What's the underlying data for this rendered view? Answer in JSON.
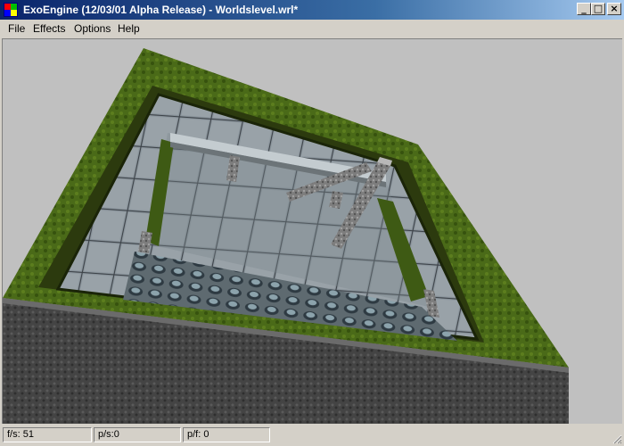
{
  "window": {
    "title": "ExoEngine (12/03/01 Alpha Release) - Worldslevel.wrl*",
    "minimize_label": "_",
    "maximize_label": "□",
    "close_label": "×"
  },
  "menu": {
    "items": [
      {
        "label": "File"
      },
      {
        "label": "Effects"
      },
      {
        "label": "Options"
      },
      {
        "label": "Help"
      }
    ]
  },
  "viewport": {
    "background_color": "#c0c0c0",
    "scene": "3d-level-render"
  },
  "statusbar": {
    "panels": [
      {
        "label": "f/s: 51"
      },
      {
        "label": "p/s:0"
      },
      {
        "label": "p/f: 0"
      }
    ]
  }
}
